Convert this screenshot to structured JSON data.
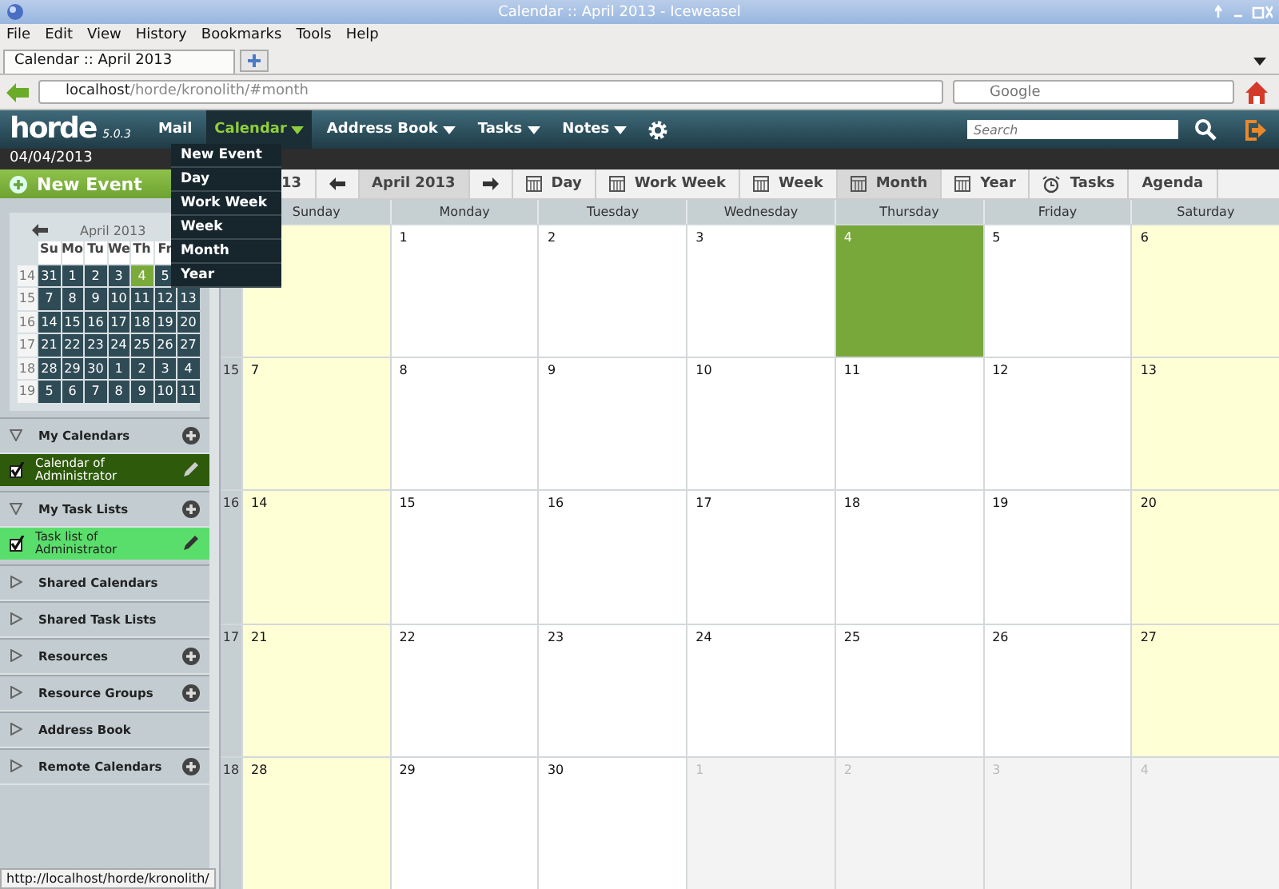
{
  "window": {
    "title": "Calendar :: April 2013 - Iceweasel"
  },
  "menu_bar": [
    "File",
    "Edit",
    "View",
    "History",
    "Bookmarks",
    "Tools",
    "Help"
  ],
  "browser_tabs": [
    {
      "label": "Calendar :: April 2013",
      "selected": true
    }
  ],
  "address_bar": {
    "host": "localhost",
    "path": "/horde/kronolith/#month"
  },
  "web_search": {
    "placeholder": "Google"
  },
  "app_bar": {
    "logo": "horde",
    "version": "5.0.3",
    "menus": [
      {
        "label": "Mail",
        "selected": false,
        "has_menu": false
      },
      {
        "label": "Calendar",
        "selected": true,
        "has_menu": true
      },
      {
        "label": "Address Book",
        "selected": false,
        "has_menu": true
      },
      {
        "label": "Tasks",
        "selected": false,
        "has_menu": true
      },
      {
        "label": "Notes",
        "selected": false,
        "has_menu": true
      }
    ],
    "search": {
      "placeholder": "Search"
    }
  },
  "date_bar": "04/04/2013",
  "dropdown": [
    "New Event",
    "Day",
    "Work Week",
    "Week",
    "Month",
    "Year"
  ],
  "sidebar": {
    "new_event": "New Event",
    "mini_calendar": {
      "title": "April 2013",
      "weekdays": [
        "Su",
        "Mo",
        "Tu",
        "We",
        "Th",
        "Fr"
      ],
      "weeks": [
        {
          "week": "14",
          "days": [
            {
              "day": "31",
              "today": false
            },
            {
              "day": "1",
              "today": false
            },
            {
              "day": "2",
              "today": false
            },
            {
              "day": "3",
              "today": false
            },
            {
              "day": "4",
              "today": true
            },
            {
              "day": "5",
              "today": false
            }
          ]
        },
        {
          "week": "15",
          "days": [
            {
              "day": "7",
              "today": false
            },
            {
              "day": "8",
              "today": false
            },
            {
              "day": "9",
              "today": false
            },
            {
              "day": "10",
              "today": false
            },
            {
              "day": "11",
              "today": false
            },
            {
              "day": "12",
              "today": false
            },
            {
              "day": "13",
              "today": false
            }
          ]
        },
        {
          "week": "16",
          "days": [
            {
              "day": "14",
              "today": false
            },
            {
              "day": "15",
              "today": false
            },
            {
              "day": "16",
              "today": false
            },
            {
              "day": "17",
              "today": false
            },
            {
              "day": "18",
              "today": false
            },
            {
              "day": "19",
              "today": false
            },
            {
              "day": "20",
              "today": false
            }
          ]
        },
        {
          "week": "17",
          "days": [
            {
              "day": "21",
              "today": false
            },
            {
              "day": "22",
              "today": false
            },
            {
              "day": "23",
              "today": false
            },
            {
              "day": "24",
              "today": false
            },
            {
              "day": "25",
              "today": false
            },
            {
              "day": "26",
              "today": false
            },
            {
              "day": "27",
              "today": false
            }
          ]
        },
        {
          "week": "18",
          "days": [
            {
              "day": "28",
              "today": false
            },
            {
              "day": "29",
              "today": false
            },
            {
              "day": "30",
              "today": false
            },
            {
              "day": "1",
              "today": false
            },
            {
              "day": "2",
              "today": false
            },
            {
              "day": "3",
              "today": false
            },
            {
              "day": "4",
              "today": false
            }
          ]
        },
        {
          "week": "19",
          "days": [
            {
              "day": "5",
              "today": false
            },
            {
              "day": "6",
              "today": false
            },
            {
              "day": "7",
              "today": false
            },
            {
              "day": "8",
              "today": false
            },
            {
              "day": "9",
              "today": false
            },
            {
              "day": "10",
              "today": false
            },
            {
              "day": "11",
              "today": false
            }
          ]
        }
      ]
    },
    "sections": [
      {
        "title": "My Calendars",
        "expanded": true,
        "addable": true,
        "items": [
          {
            "label": "Calendar of Administrator",
            "checked": true,
            "color": "#2e5a0c"
          }
        ]
      },
      {
        "title": "My Task Lists",
        "expanded": true,
        "addable": true,
        "items": [
          {
            "label": "Task list of Administrator",
            "checked": true,
            "color": "#5ade6b"
          }
        ]
      },
      {
        "title": "Shared Calendars",
        "expanded": false,
        "addable": false
      },
      {
        "title": "Shared Task Lists",
        "expanded": false,
        "addable": false
      },
      {
        "title": "Resources",
        "expanded": false,
        "addable": true
      },
      {
        "title": "Resource Groups",
        "expanded": false,
        "addable": true
      },
      {
        "title": "Address Book",
        "expanded": false,
        "addable": false
      },
      {
        "title": "Remote Calendars",
        "expanded": false,
        "addable": true
      }
    ]
  },
  "toolbar": {
    "partial_label": "13",
    "period": "April 2013",
    "views": [
      {
        "label": "Day",
        "kind": "period",
        "selected": false
      },
      {
        "label": "Work Week",
        "kind": "period",
        "selected": false
      },
      {
        "label": "Week",
        "kind": "period",
        "selected": false
      },
      {
        "label": "Month",
        "kind": "period",
        "selected": true
      },
      {
        "label": "Year",
        "kind": "period",
        "selected": false
      },
      {
        "label": "Tasks",
        "kind": "tasks",
        "selected": false
      },
      {
        "label": "Agenda",
        "kind": "list",
        "selected": false
      }
    ]
  },
  "month": {
    "weekdays": [
      {
        "name": "Sunday",
        "weekend": true
      },
      {
        "name": "Monday",
        "weekend": false
      },
      {
        "name": "Tuesday",
        "weekend": false
      },
      {
        "name": "Wednesday",
        "weekend": false
      },
      {
        "name": "Thursday",
        "weekend": false
      },
      {
        "name": "Friday",
        "weekend": false
      },
      {
        "name": "Saturday",
        "weekend": true
      }
    ],
    "weeks": [
      {
        "days": [
          {
            "today": false,
            "other_month": false
          },
          {
            "day": "1",
            "today": false,
            "other_month": false
          },
          {
            "day": "2",
            "today": false,
            "other_month": false
          },
          {
            "day": "3",
            "today": false,
            "other_month": false
          },
          {
            "day": "4",
            "today": true,
            "other_month": false
          },
          {
            "day": "5",
            "today": false,
            "other_month": false
          },
          {
            "day": "6",
            "today": false,
            "other_month": false
          }
        ]
      },
      {
        "week": "15",
        "days": [
          {
            "day": "7",
            "today": false,
            "other_month": false
          },
          {
            "day": "8",
            "today": false,
            "other_month": false
          },
          {
            "day": "9",
            "today": false,
            "other_month": false
          },
          {
            "day": "10",
            "today": false,
            "other_month": false
          },
          {
            "day": "11",
            "today": false,
            "other_month": false
          },
          {
            "day": "12",
            "today": false,
            "other_month": false
          },
          {
            "day": "13",
            "today": false,
            "other_month": false
          }
        ]
      },
      {
        "week": "16",
        "days": [
          {
            "day": "14",
            "today": false,
            "other_month": false
          },
          {
            "day": "15",
            "today": false,
            "other_month": false
          },
          {
            "day": "16",
            "today": false,
            "other_month": false
          },
          {
            "day": "17",
            "today": false,
            "other_month": false
          },
          {
            "day": "18",
            "today": false,
            "other_month": false
          },
          {
            "day": "19",
            "today": false,
            "other_month": false
          },
          {
            "day": "20",
            "today": false,
            "other_month": false
          }
        ]
      },
      {
        "week": "17",
        "days": [
          {
            "day": "21",
            "today": false,
            "other_month": false
          },
          {
            "day": "22",
            "today": false,
            "other_month": false
          },
          {
            "day": "23",
            "today": false,
            "other_month": false
          },
          {
            "day": "24",
            "today": false,
            "other_month": false
          },
          {
            "day": "25",
            "today": false,
            "other_month": false
          },
          {
            "day": "26",
            "today": false,
            "other_month": false
          },
          {
            "day": "27",
            "today": false,
            "other_month": false
          }
        ]
      },
      {
        "week": "18",
        "days": [
          {
            "day": "28",
            "today": false,
            "other_month": false
          },
          {
            "day": "29",
            "today": false,
            "other_month": false
          },
          {
            "day": "30",
            "today": false,
            "other_month": false
          },
          {
            "day": "1",
            "today": false,
            "other_month": true
          },
          {
            "day": "2",
            "today": false,
            "other_month": true
          },
          {
            "day": "3",
            "today": false,
            "other_month": true
          },
          {
            "day": "4",
            "today": false,
            "other_month": true
          }
        ]
      }
    ]
  },
  "status_bar": "http://localhost/horde/kronolith/"
}
